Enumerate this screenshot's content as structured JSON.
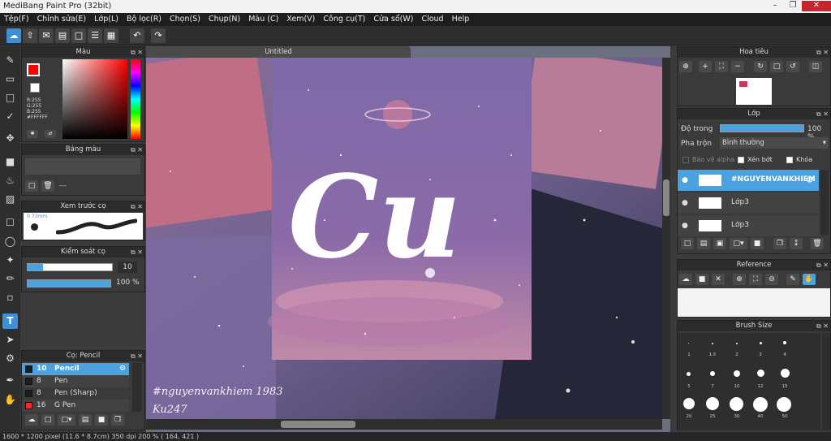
{
  "app": {
    "title": "MediBang Paint Pro (32bit)"
  },
  "menu": [
    "Tệp(F)",
    "Chỉnh sửa(E)",
    "Lớp(L)",
    "Bộ lọc(R)",
    "Chọn(S)",
    "Chụp(N)",
    "Màu (C)",
    "Xem(V)",
    "Công cụ(T)",
    "Cửa sổ(W)",
    "Cloud",
    "Help"
  ],
  "canvas": {
    "tab_title": "Untitled",
    "big_text": "Cu",
    "watermark_line1": "#nguyenvankhiem 1983",
    "watermark_line2": "Ku247"
  },
  "color_panel": {
    "title": "Màu",
    "r": "R:255",
    "g": "G:255",
    "b": "B:255",
    "hex": "#FFFFFF",
    "primary_color": "#ff0000",
    "secondary_color": "#ffffff"
  },
  "palette_panel": {
    "title": "Bảng màu",
    "dashes": "---"
  },
  "brush_preview": {
    "title": "Xem trước cọ",
    "size": "0.73mm"
  },
  "brush_control": {
    "title": "Kiểm soát cọ",
    "size_value": "10",
    "opacity_value": "100 %"
  },
  "brush_list": {
    "title": "Cọ: Pencil",
    "items": [
      {
        "size": "10",
        "name": "Pencil",
        "color": "#1e1e1e",
        "selected": true
      },
      {
        "size": "8",
        "name": "Pen",
        "color": "#1e1e1e",
        "selected": false
      },
      {
        "size": "8",
        "name": "Pen (Sharp)",
        "color": "#1e1e1e",
        "selected": false
      },
      {
        "size": "16",
        "name": "G Pen",
        "color": "#e83030",
        "selected": false
      }
    ]
  },
  "navigator": {
    "title": "Hoa tiêu"
  },
  "layer_panel": {
    "title": "Lớp",
    "opacity_label": "Độ trong",
    "opacity_value": "100 %",
    "blend_label": "Pha trộn",
    "blend_value": "Bình thường",
    "protect_alpha": "Bảo vệ alpha",
    "clipping": "Xén bớt",
    "lock": "Khóa",
    "layers": [
      {
        "name": "#NGUYENVANKHIEM",
        "selected": true
      },
      {
        "name": "Lớp3",
        "selected": false
      },
      {
        "name": "Lớp3",
        "selected": false
      }
    ]
  },
  "reference": {
    "title": "Reference"
  },
  "brush_size": {
    "title": "Brush Size",
    "labels": [
      "1",
      "1.5",
      "2",
      "3",
      "4",
      "5",
      "7",
      "10",
      "12",
      "15",
      "20",
      "25",
      "30",
      "40",
      "50"
    ]
  },
  "status": {
    "text": "1600 * 1200 pixel   (11.6 * 8.7cm)   350 dpi   200 %   ( 164, 421 )"
  }
}
